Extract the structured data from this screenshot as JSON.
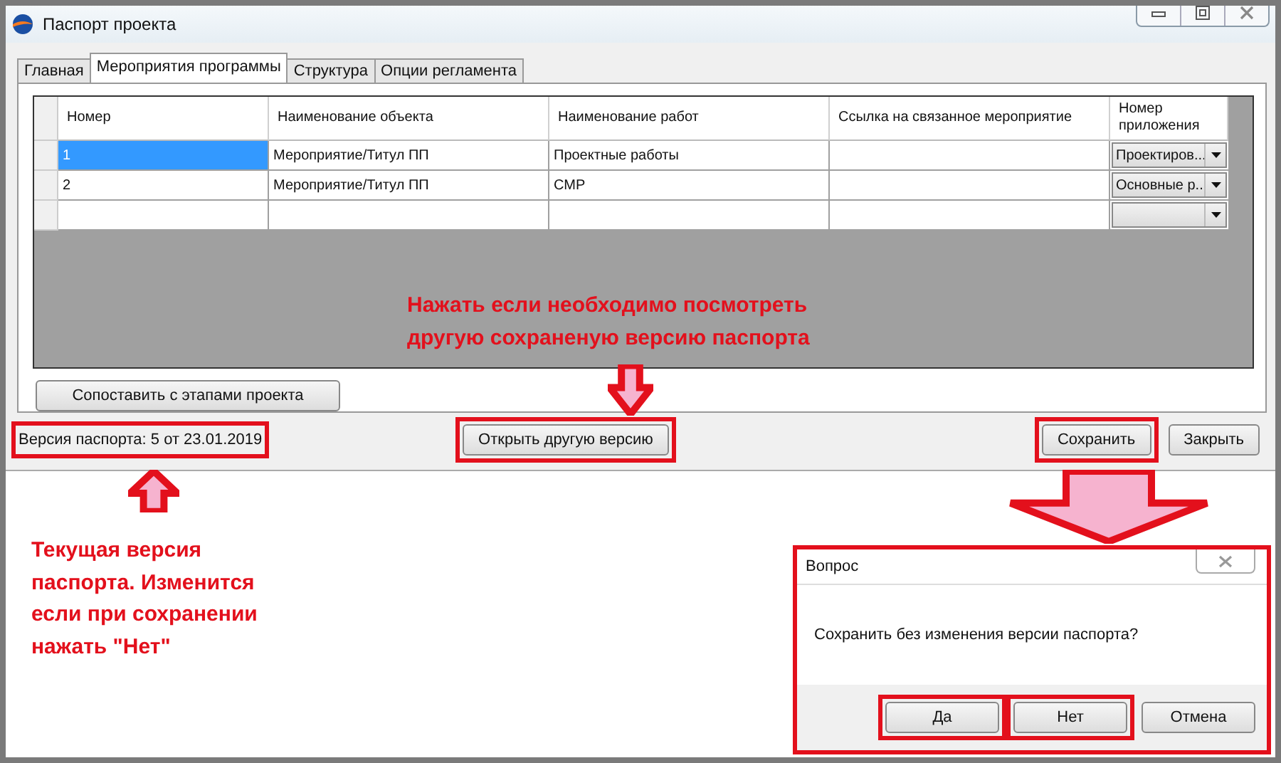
{
  "window": {
    "title": "Паспорт проекта"
  },
  "tabs": [
    {
      "label": "Главная",
      "selected": false
    },
    {
      "label": "Мероприятия программы",
      "selected": true
    },
    {
      "label": "Структура",
      "selected": false
    },
    {
      "label": "Опции регламента",
      "selected": false
    }
  ],
  "table": {
    "columns": [
      "Номер",
      "Наименование объекта",
      "Наименование работ",
      "Ссылка на связанное мероприятие",
      "Номер приложения"
    ],
    "rows": [
      {
        "number": "1",
        "object": "Мероприятие/Титул ПП",
        "works": "Проектные работы",
        "appendix": "Проектиров...",
        "selected": true
      },
      {
        "number": "2",
        "object": "Мероприятие/Титул ПП",
        "works": "СМР",
        "appendix": "Основные р...",
        "selected": false
      }
    ]
  },
  "compare_button": "Сопоставить с этапами проекта",
  "version_label": {
    "text": "Версия паспорта: 5 от 23.01.2019",
    "highlighted": true
  },
  "open_button": {
    "label": "Открыть другую версию",
    "highlighted": true
  },
  "save_button": {
    "label": "Сохранить",
    "highlighted": true
  },
  "close_button": {
    "label": "Закрыть",
    "highlighted": false
  },
  "annotations": [
    {
      "lines": [
        "Нажать если необходимо посмотреть",
        "другую сохраненую версию паспорта"
      ]
    },
    {
      "lines": [
        "Текущая версия",
        "паспорта. Изменится",
        "если при сохранении",
        "нажать \"Нет\""
      ]
    }
  ],
  "dialog": {
    "title": "Вопрос",
    "message": "Сохранить без изменения версии паспорта?",
    "buttons": [
      {
        "label": "Да",
        "highlighted": true
      },
      {
        "label": "Нет",
        "highlighted": true
      },
      {
        "label": "Отмена",
        "highlighted": false
      }
    ]
  }
}
